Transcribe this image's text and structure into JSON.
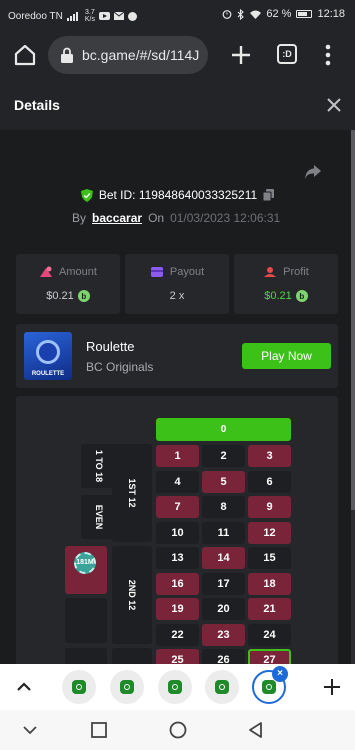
{
  "status": {
    "carrier": "Ooredoo TN",
    "net_speed": "3.7",
    "net_unit": "K/s",
    "battery": "62 %",
    "battery_level": 0.62,
    "time": "12:18"
  },
  "browser": {
    "url": "bc.game/#/sd/114J",
    "tabs_label": ":D"
  },
  "details": {
    "title": "Details"
  },
  "bet": {
    "id_label": "Bet ID: 119848640033325211",
    "by": "By",
    "user": "baccarar",
    "on": "On",
    "date": "01/03/2023 12:06:31"
  },
  "stats": [
    {
      "label": "Amount",
      "value": "$0.21"
    },
    {
      "label": "Payout",
      "value": "2 x"
    },
    {
      "label": "Profit",
      "value": "$0.21"
    }
  ],
  "game": {
    "name": "Roulette",
    "provider": "BC Originals",
    "play_label": "Play Now",
    "thumb_text": "ROULETTE"
  },
  "board": {
    "zero": "0",
    "side_labels": [
      "1 TO 18",
      "EVEN",
      "1ST 12",
      "2ND 12"
    ],
    "chip_label": "181M",
    "rows": [
      [
        "1",
        "2",
        "3"
      ],
      [
        "4",
        "5",
        "6"
      ],
      [
        "7",
        "8",
        "9"
      ],
      [
        "10",
        "11",
        "12"
      ],
      [
        "13",
        "14",
        "15"
      ],
      [
        "16",
        "17",
        "18"
      ],
      [
        "19",
        "20",
        "21"
      ],
      [
        "22",
        "23",
        "24"
      ],
      [
        "25",
        "26",
        "27"
      ]
    ],
    "colors": {
      "red": "#7a2439",
      "black": "#1e1f22",
      "green": "#3bc117"
    }
  },
  "colors": {
    "accent_green": "#3bc117",
    "profit_green": "#4fd64a",
    "tab_blue": "#1c6bd8"
  }
}
